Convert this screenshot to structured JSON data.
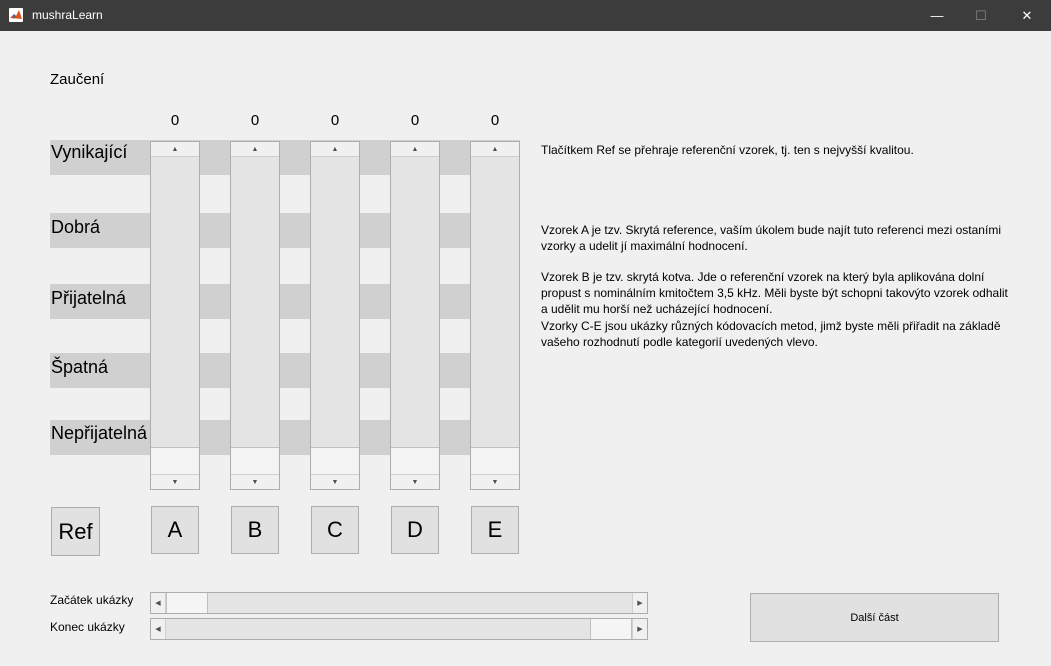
{
  "window": {
    "title": "mushraLearn",
    "accent": "#3c3c3c"
  },
  "heading": "Zaučení",
  "categories": [
    "Vynikající",
    "Dobrá",
    "Přijatelná",
    "Špatná",
    "Nepřijatelná"
  ],
  "samples": [
    {
      "label": "A",
      "value": "0"
    },
    {
      "label": "B",
      "value": "0"
    },
    {
      "label": "C",
      "value": "0"
    },
    {
      "label": "D",
      "value": "0"
    },
    {
      "label": "E",
      "value": "0"
    }
  ],
  "ref_button": "Ref",
  "info": {
    "ref": "Tlačítkem Ref se přehraje referenční vzorek, tj. ten s nejvyšší kvalitou.",
    "a": "Vzorek A je tzv. Skrytá reference, vaším úkolem bude najít tuto referenci mezi ostaními vzorky a udelit jí maximální hodnocení.",
    "b": "Vzorek B je tzv. skrytá kotva. Jde o referenční vzorek na který byla aplikována dolní propust s nominálním kmitočtem 3,5 kHz. Měli byste být schopni takovýto vzorek odhalit a udělit mu horší než ucházející hodnocení.",
    "ce": "Vzorky C-E jsou ukázky různých kódovacích metod, jimž byste měli přiřadit na základě vašeho rozhodnutí podle kategorií uvedených vlevo."
  },
  "playback": {
    "start_label": "Začátek ukázky",
    "end_label": "Konec ukázky",
    "start_fraction": 0.0,
    "end_fraction": 1.0
  },
  "next_button": "Další část",
  "icons": {
    "min": "minimize-icon",
    "max": "maximize-icon",
    "close": "close-icon"
  }
}
